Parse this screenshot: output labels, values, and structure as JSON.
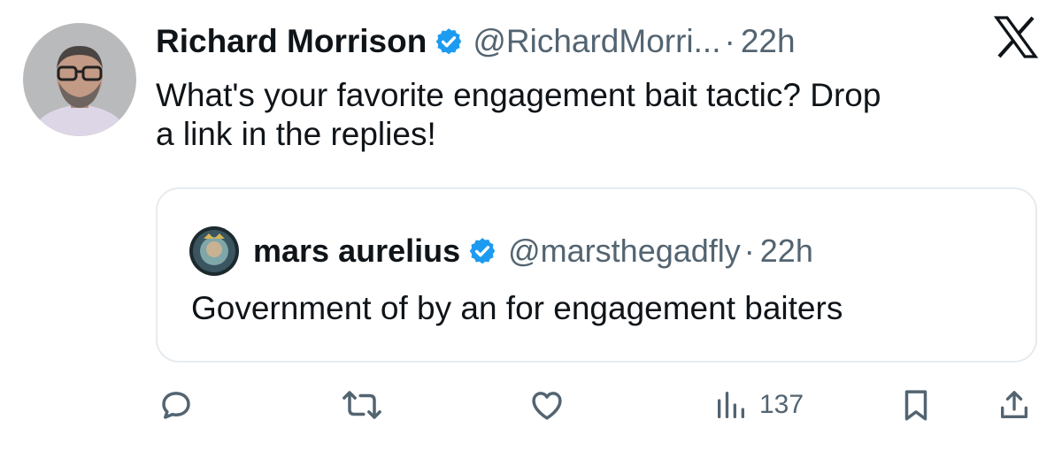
{
  "tweet": {
    "author_name": "Richard Morrison",
    "handle": "@RichardMorri...",
    "separator": "·",
    "time": "22h",
    "text_lines": [
      "What's your favorite engagement bait tactic? Drop",
      "a link in the replies!"
    ]
  },
  "quoted": {
    "author_name": "mars aurelius",
    "handle": "@marsthegadfly",
    "separator": "·",
    "time": "22h",
    "text": "Government of by an for engagement baiters"
  },
  "actions": {
    "views": "137"
  },
  "icons": [
    "verified-badge-icon",
    "x-logo-icon",
    "reply-icon",
    "retweet-icon",
    "like-icon",
    "views-icon",
    "bookmark-icon",
    "share-icon"
  ],
  "colors": {
    "verified": "#1d9bf0",
    "text": "#0f1419",
    "secondary": "#536471",
    "border": "#e6ebef"
  }
}
